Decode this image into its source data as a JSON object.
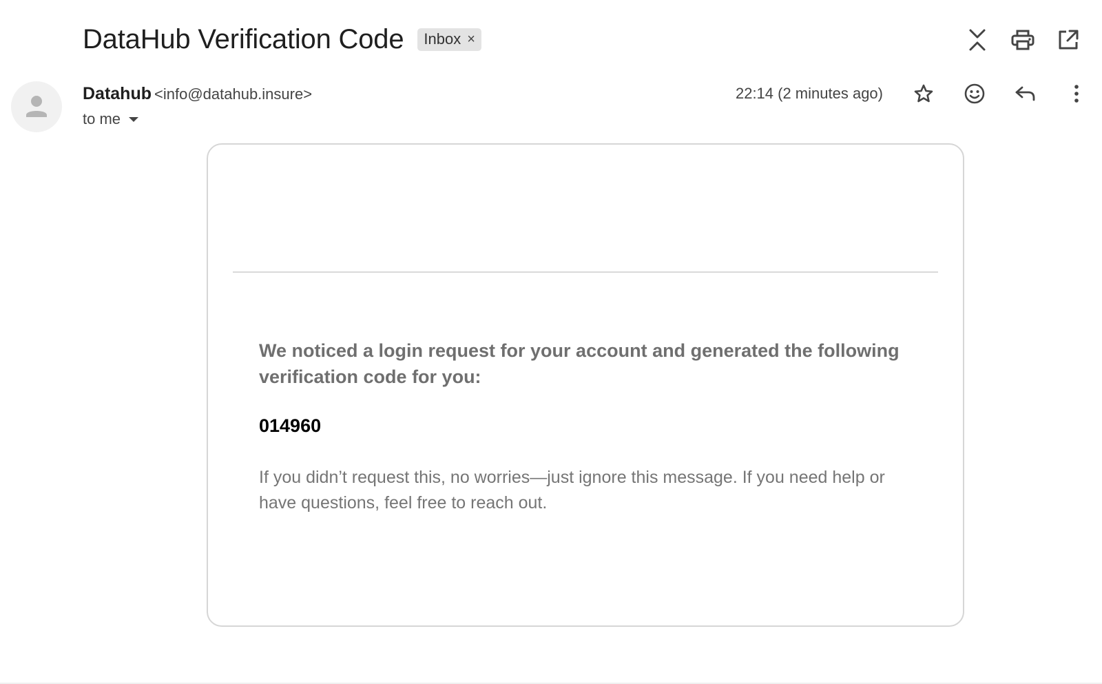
{
  "header": {
    "subject": "DataHub Verification Code",
    "label_chip": "Inbox",
    "label_remove_glyph": "×",
    "actions": [
      {
        "name": "collapse-all-icon"
      },
      {
        "name": "print-icon"
      },
      {
        "name": "open-in-new-window-icon"
      }
    ]
  },
  "message": {
    "sender_name": "Datahub",
    "sender_email": "<info@datahub.insure>",
    "recipient": "to me",
    "timestamp": "22:14 (2 minutes ago)",
    "actions": [
      {
        "name": "star-icon"
      },
      {
        "name": "emoji-reaction-icon"
      },
      {
        "name": "reply-icon"
      },
      {
        "name": "more-options-icon"
      }
    ]
  },
  "body": {
    "intro": "We noticed a login request for your account and generated the following verification code for you:",
    "code": "014960",
    "footer": "If you didn’t request this, no worries—just ignore this message. If you need help or have questions, feel free to reach out."
  },
  "colors": {
    "chip_bg": "#e3e3e3",
    "text_primary": "#1f1f1f",
    "text_secondary": "#444444",
    "body_gray": "#6f6f6f",
    "card_border": "#d6d6d6"
  }
}
